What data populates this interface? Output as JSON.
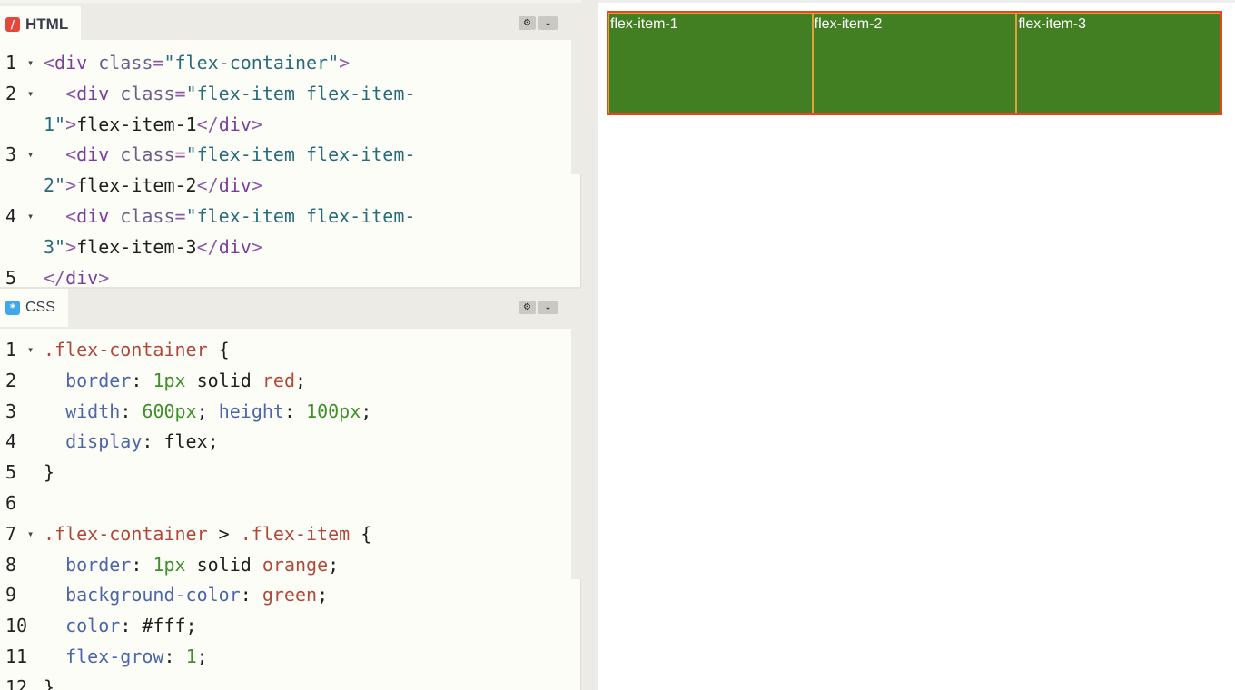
{
  "html_pane": {
    "title": "HTML",
    "icon": "html-slash-icon",
    "lines": [
      {
        "n": "1",
        "fold": true,
        "parts": [
          [
            "t-punct",
            "<"
          ],
          [
            "t-tag",
            "div"
          ],
          [
            "t-attr",
            " class"
          ],
          [
            "t-punct",
            "="
          ],
          [
            "t-str-s",
            "\"flex-container\""
          ],
          [
            "t-punct",
            ">"
          ]
        ]
      },
      {
        "n": "2",
        "fold": true,
        "parts": [
          [
            "t-plain",
            "  "
          ],
          [
            "t-punct",
            "<"
          ],
          [
            "t-tag",
            "div"
          ],
          [
            "t-attr",
            " class"
          ],
          [
            "t-punct",
            "="
          ],
          [
            "t-str-s",
            "\"flex-item flex-item-"
          ]
        ]
      },
      {
        "n": "",
        "fold": false,
        "parts": [
          [
            "t-str-s",
            "1\""
          ],
          [
            "t-punct",
            ">"
          ],
          [
            "t-plain",
            "flex-item-1"
          ],
          [
            "t-punct",
            "</"
          ],
          [
            "t-tag",
            "div"
          ],
          [
            "t-punct",
            ">"
          ]
        ]
      },
      {
        "n": "3",
        "fold": true,
        "parts": [
          [
            "t-plain",
            "  "
          ],
          [
            "t-punct",
            "<"
          ],
          [
            "t-tag",
            "div"
          ],
          [
            "t-attr",
            " class"
          ],
          [
            "t-punct",
            "="
          ],
          [
            "t-str-s",
            "\"flex-item flex-item-"
          ]
        ]
      },
      {
        "n": "",
        "fold": false,
        "parts": [
          [
            "t-str-s",
            "2\""
          ],
          [
            "t-punct",
            ">"
          ],
          [
            "t-plain",
            "flex-item-2"
          ],
          [
            "t-punct",
            "</"
          ],
          [
            "t-tag",
            "div"
          ],
          [
            "t-punct",
            ">"
          ]
        ]
      },
      {
        "n": "4",
        "fold": true,
        "parts": [
          [
            "t-plain",
            "  "
          ],
          [
            "t-punct",
            "<"
          ],
          [
            "t-tag",
            "div"
          ],
          [
            "t-attr",
            " class"
          ],
          [
            "t-punct",
            "="
          ],
          [
            "t-str-s",
            "\"flex-item flex-item-"
          ]
        ]
      },
      {
        "n": "",
        "fold": false,
        "parts": [
          [
            "t-str-s",
            "3\""
          ],
          [
            "t-punct",
            ">"
          ],
          [
            "t-plain",
            "flex-item-3"
          ],
          [
            "t-punct",
            "</"
          ],
          [
            "t-tag",
            "div"
          ],
          [
            "t-punct",
            ">"
          ]
        ]
      },
      {
        "n": "5",
        "fold": false,
        "parts": [
          [
            "t-punct",
            "</"
          ],
          [
            "t-tag",
            "div"
          ],
          [
            "t-punct",
            ">"
          ]
        ]
      }
    ]
  },
  "css_pane": {
    "title": "CSS",
    "icon": "css-asterisk-icon",
    "lines": [
      {
        "n": "1",
        "fold": true,
        "parts": [
          [
            "t-sel",
            ".flex-container"
          ],
          [
            "t-plain",
            " {"
          ]
        ]
      },
      {
        "n": "2",
        "fold": false,
        "parts": [
          [
            "t-plain",
            "  "
          ],
          [
            "t-prop",
            "border"
          ],
          [
            "t-plain",
            ": "
          ],
          [
            "t-num",
            "1px"
          ],
          [
            "t-plain",
            " solid "
          ],
          [
            "t-kw",
            "red"
          ],
          [
            "t-plain",
            ";"
          ]
        ]
      },
      {
        "n": "3",
        "fold": false,
        "parts": [
          [
            "t-plain",
            "  "
          ],
          [
            "t-prop",
            "width"
          ],
          [
            "t-plain",
            ": "
          ],
          [
            "t-num",
            "600px"
          ],
          [
            "t-plain",
            "; "
          ],
          [
            "t-prop",
            "height"
          ],
          [
            "t-plain",
            ": "
          ],
          [
            "t-num",
            "100px"
          ],
          [
            "t-plain",
            ";"
          ]
        ]
      },
      {
        "n": "4",
        "fold": false,
        "parts": [
          [
            "t-plain",
            "  "
          ],
          [
            "t-prop",
            "display"
          ],
          [
            "t-plain",
            ": flex;"
          ]
        ]
      },
      {
        "n": "5",
        "fold": false,
        "parts": [
          [
            "t-plain",
            "}"
          ]
        ]
      },
      {
        "n": "6",
        "fold": false,
        "parts": [
          [
            "t-plain",
            ""
          ]
        ]
      },
      {
        "n": "7",
        "fold": true,
        "parts": [
          [
            "t-sel",
            ".flex-container"
          ],
          [
            "t-plain",
            " > "
          ],
          [
            "t-sel",
            ".flex-item"
          ],
          [
            "t-plain",
            " {"
          ]
        ]
      },
      {
        "n": "8",
        "fold": false,
        "parts": [
          [
            "t-plain",
            "  "
          ],
          [
            "t-prop",
            "border"
          ],
          [
            "t-plain",
            ": "
          ],
          [
            "t-num",
            "1px"
          ],
          [
            "t-plain",
            " solid "
          ],
          [
            "t-kw",
            "orange"
          ],
          [
            "t-plain",
            ";"
          ]
        ]
      },
      {
        "n": "9",
        "fold": false,
        "parts": [
          [
            "t-plain",
            "  "
          ],
          [
            "t-prop",
            "background-color"
          ],
          [
            "t-plain",
            ": "
          ],
          [
            "t-kw",
            "green"
          ],
          [
            "t-plain",
            ";"
          ]
        ]
      },
      {
        "n": "10",
        "fold": false,
        "parts": [
          [
            "t-plain",
            "  "
          ],
          [
            "t-prop",
            "color"
          ],
          [
            "t-plain",
            ": #fff;"
          ]
        ]
      },
      {
        "n": "11",
        "fold": false,
        "parts": [
          [
            "t-plain",
            "  "
          ],
          [
            "t-prop",
            "flex-grow"
          ],
          [
            "t-plain",
            ": "
          ],
          [
            "t-num",
            "1"
          ],
          [
            "t-plain",
            ";"
          ]
        ]
      },
      {
        "n": "12",
        "fold": false,
        "parts": [
          [
            "t-plain",
            "}"
          ]
        ]
      }
    ]
  },
  "toolbar": {
    "settings_icon": "gear-icon",
    "settings_glyph": "⚙",
    "collapse_icon": "chevron-down-icon",
    "collapse_glyph": "⌄"
  },
  "preview": {
    "container_border_color": "#e8471d",
    "item_bg_color": "#417f22",
    "item_border_color": "#e0a13b",
    "items": [
      "flex-item-1",
      "flex-item-2",
      "flex-item-3"
    ]
  }
}
